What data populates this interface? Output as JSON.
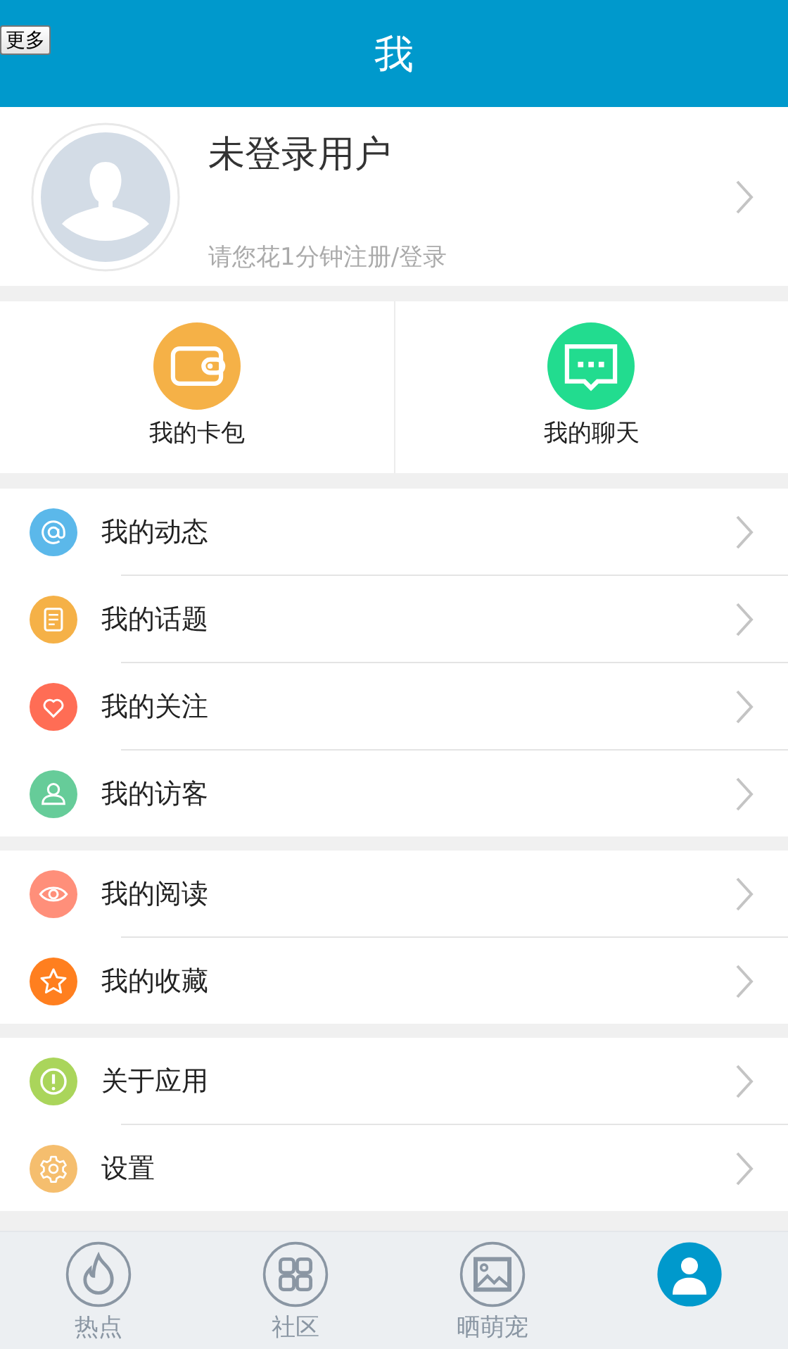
{
  "more_button": "更多",
  "header": {
    "title": "我"
  },
  "profile": {
    "name": "未登录用户",
    "hint": "请您花1分钟注册/登录"
  },
  "shortcuts": [
    {
      "label": "我的卡包",
      "kind": "wallet",
      "color": "#f5b147"
    },
    {
      "label": "我的聊天",
      "kind": "chat",
      "color": "#22dc8f"
    }
  ],
  "menu_groups": [
    [
      {
        "label": "我的动态",
        "kind": "at",
        "color": "#5bb8ea"
      },
      {
        "label": "我的话题",
        "kind": "note",
        "color": "#f5b147"
      },
      {
        "label": "我的关注",
        "kind": "heart",
        "color": "#ff6d55"
      },
      {
        "label": "我的访客",
        "kind": "person",
        "color": "#66cc99"
      }
    ],
    [
      {
        "label": "我的阅读",
        "kind": "eye",
        "color": "#ff8f7a"
      },
      {
        "label": "我的收藏",
        "kind": "star",
        "color": "#ff7f1f"
      }
    ],
    [
      {
        "label": "关于应用",
        "kind": "info",
        "color": "#aad55b"
      },
      {
        "label": "设置",
        "kind": "gear",
        "color": "#f5be6e"
      }
    ]
  ],
  "tab_bar": [
    {
      "label": "热点",
      "kind": "flame",
      "selected": false
    },
    {
      "label": "社区",
      "kind": "grid",
      "selected": false
    },
    {
      "label": "晒萌宠",
      "kind": "image",
      "selected": false
    },
    {
      "kind": "person",
      "selected": true
    }
  ]
}
